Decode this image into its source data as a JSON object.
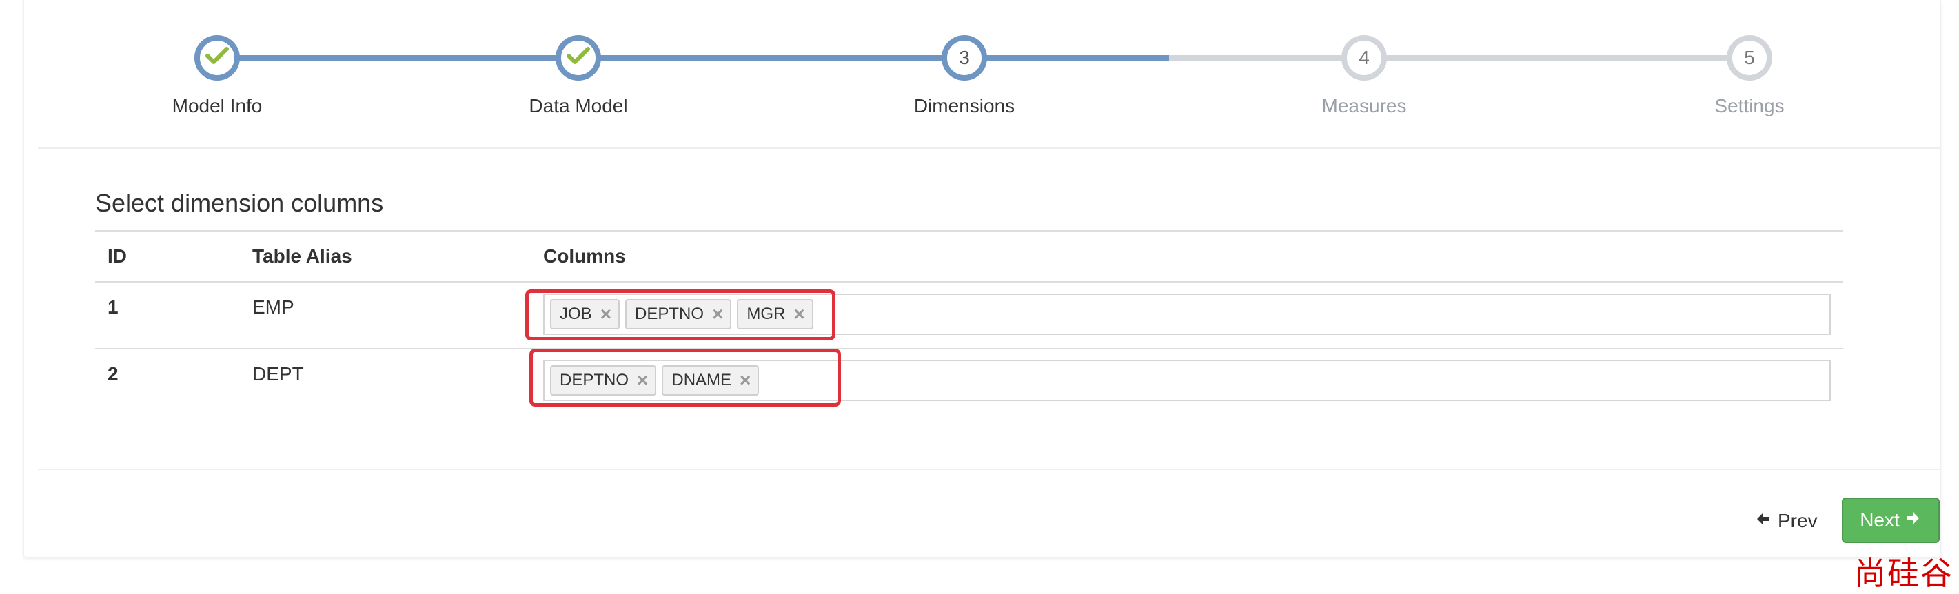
{
  "wizard": {
    "steps": [
      {
        "number": "1",
        "label": "Model Info",
        "state": "done"
      },
      {
        "number": "2",
        "label": "Data Model",
        "state": "done"
      },
      {
        "number": "3",
        "label": "Dimensions",
        "state": "active"
      },
      {
        "number": "4",
        "label": "Measures",
        "state": "pending"
      },
      {
        "number": "5",
        "label": "Settings",
        "state": "pending"
      }
    ],
    "done_icon": "check-icon",
    "colors": {
      "complete": "#6f95c3",
      "incomplete": "#d2d5da",
      "check": "#8fbb3c"
    }
  },
  "main": {
    "title": "Select dimension columns",
    "table": {
      "headers": {
        "id": "ID",
        "alias": "Table Alias",
        "columns": "Columns"
      },
      "rows": [
        {
          "id": "1",
          "alias": "EMP",
          "tags": [
            "JOB",
            "DEPTNO",
            "MGR"
          ]
        },
        {
          "id": "2",
          "alias": "DEPT",
          "tags": [
            "DEPTNO",
            "DNAME"
          ]
        }
      ],
      "tag_remove_icon": "close-icon"
    },
    "highlight_color": "#e0303a"
  },
  "footer": {
    "prev_label": "Prev",
    "prev_icon": "arrow-left-icon",
    "next_label": "Next",
    "next_icon": "arrow-right-icon",
    "next_color": "#5cb85c"
  },
  "watermark": {
    "text": "尚硅谷",
    "color": "#d40000"
  }
}
